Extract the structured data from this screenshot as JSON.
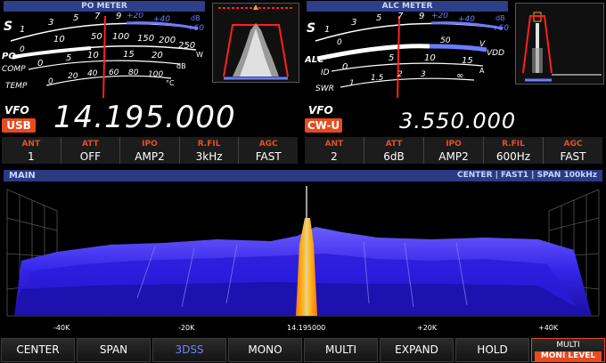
{
  "left_meter": {
    "title": "PO METER",
    "scales": {
      "s_label": "S",
      "s_ticks": [
        "1",
        "3",
        "5",
        "7",
        "9",
        "+20",
        "+40",
        "+60"
      ],
      "s_unit": "dB",
      "po_label": "PO",
      "po_ticks": [
        "0",
        "10",
        "50",
        "100",
        "150",
        "200",
        "250"
      ],
      "po_unit": "W",
      "comp_label": "COMP",
      "comp_ticks": [
        "0",
        "5",
        "10",
        "15",
        "20"
      ],
      "comp_unit": "dB",
      "temp_label": "TEMP",
      "temp_ticks": [
        "0",
        "20",
        "40",
        "60",
        "80",
        "100"
      ],
      "temp_unit": "°C"
    }
  },
  "right_meter": {
    "title": "ALC METER",
    "scales": {
      "s_label": "S",
      "s_ticks": [
        "1",
        "3",
        "5",
        "7",
        "9",
        "+20",
        "+40",
        "+60"
      ],
      "s_unit": "dB",
      "alc_label": "ALC",
      "alc_ticks": [
        "0",
        "50",
        "V"
      ],
      "vdd_label": "VDD",
      "id_label": "ID",
      "id_ticks": [
        "0",
        "5",
        "10",
        "15"
      ],
      "id_unit": "A",
      "swr_label": "SWR",
      "swr_ticks": [
        "1",
        "1.5",
        "2",
        "3",
        "∞"
      ]
    }
  },
  "vfo_main": {
    "label": "VFO",
    "mode": "USB",
    "frequency": "14.195.000",
    "params": [
      {
        "label": "ANT",
        "value": "1"
      },
      {
        "label": "ATT",
        "value": "OFF"
      },
      {
        "label": "IPO",
        "value": "AMP2"
      },
      {
        "label": "R.FIL",
        "value": "3kHz"
      },
      {
        "label": "AGC",
        "value": "FAST"
      }
    ]
  },
  "vfo_sub": {
    "label": "VFO",
    "mode": "CW-U",
    "frequency": "3.550.000",
    "params": [
      {
        "label": "ANT",
        "value": "2"
      },
      {
        "label": "ATT",
        "value": "6dB"
      },
      {
        "label": "IPO",
        "value": "AMP2"
      },
      {
        "label": "R.FIL",
        "value": "600Hz"
      },
      {
        "label": "AGC",
        "value": "FAST"
      }
    ]
  },
  "main_scope": {
    "title": "MAIN",
    "info": "CENTER | FAST1 | SPAN   100kHz",
    "axis_labels": [
      "-40K",
      "-20K",
      "14.195000",
      "+20K",
      "+40K"
    ]
  },
  "softkeys": [
    {
      "label": "CENTER"
    },
    {
      "label": "SPAN"
    },
    {
      "label": "3DSS"
    },
    {
      "label": "MONO"
    },
    {
      "label": "MULTI"
    },
    {
      "label": "EXPAND"
    },
    {
      "label": "HOLD"
    }
  ],
  "multi_key": {
    "label": "MULTI",
    "sub": "MONI LEVEL"
  },
  "colors": {
    "accent_blue": "#2e3f8a",
    "accent_orange": "#e84a1e",
    "spectrum_blue": "#3a2dff",
    "needle_red": "#ff2020"
  }
}
